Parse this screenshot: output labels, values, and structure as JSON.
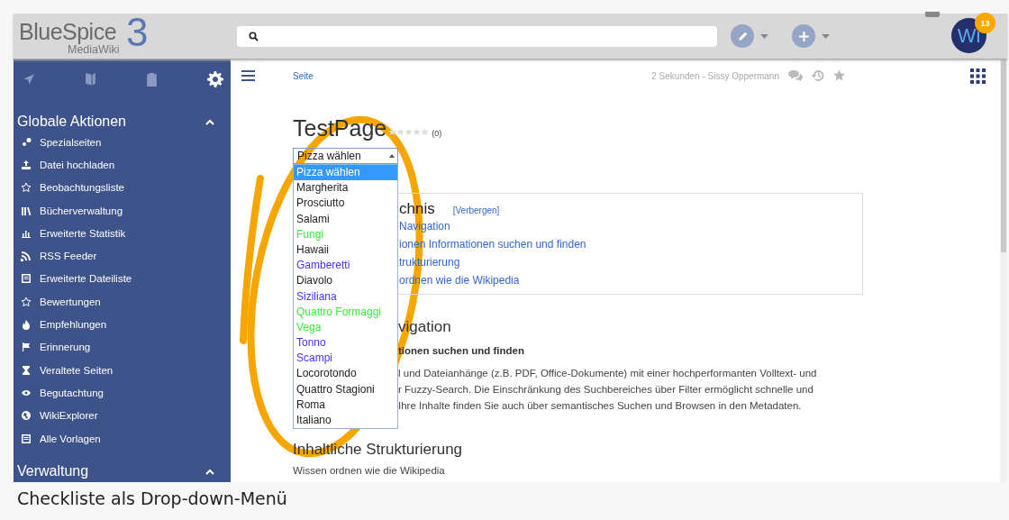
{
  "header": {
    "logo": {
      "name": "BlueSpice",
      "subtitle": "MediaWiki",
      "version": "3"
    },
    "avatar": {
      "initials": "Wi",
      "badge": "13"
    }
  },
  "sidebar": {
    "sections": [
      {
        "title": "Globale Aktionen",
        "expanded": true,
        "items": [
          "Spezialseiten",
          "Datei hochladen",
          "Beobachtungsliste",
          "Bücherverwaltung",
          "Erweiterte Statistik",
          "RSS Feeder",
          "Erweiterte Dateiliste",
          "Bewertungen",
          "Empfehlungen",
          "Erinnerung",
          "Veraltete Seiten",
          "Begutachtung",
          "WikiExplorer",
          "Alle Vorlagen"
        ]
      },
      {
        "title": "Verwaltung",
        "expanded": true
      }
    ]
  },
  "toolbar": {
    "breadcrumb": "Seite",
    "last_edit": "2 Sekunden - Sissy Oppermann"
  },
  "page": {
    "title": "TestPage",
    "rating": {
      "stars": 0,
      "count": "(0)"
    },
    "select": {
      "value": "Pizza wählen",
      "expanded": true,
      "options": [
        {
          "label": "Pizza wählen",
          "selected": true
        },
        {
          "label": "Margherita",
          "selected": false,
          "color": "#222222"
        },
        {
          "label": "Prosciutto",
          "selected": false,
          "color": "#222222"
        },
        {
          "label": "Salami",
          "selected": false,
          "color": "#222222"
        },
        {
          "label": "Fungi",
          "selected": false,
          "color": "#33ee33"
        },
        {
          "label": "Hawaii",
          "selected": false,
          "color": "#222222"
        },
        {
          "label": "Gamberetti",
          "selected": false,
          "color": "#4433ff"
        },
        {
          "label": "Diavolo",
          "selected": false,
          "color": "#222222"
        },
        {
          "label": "Siziliana",
          "selected": false,
          "color": "#4433ff"
        },
        {
          "label": "Quattro Formaggi",
          "selected": false,
          "color": "#33ee33"
        },
        {
          "label": "Vega",
          "selected": false,
          "color": "#33ee33"
        },
        {
          "label": "Tonno",
          "selected": false,
          "color": "#4433ff"
        },
        {
          "label": "Scampi",
          "selected": false,
          "color": "#4433ff"
        },
        {
          "label": "Locorotondo",
          "selected": false,
          "color": "#222222"
        },
        {
          "label": "Quattro Stagioni",
          "selected": false,
          "color": "#222222"
        },
        {
          "label": "Roma",
          "selected": false,
          "color": "#222222"
        },
        {
          "label": "Italiano",
          "selected": false,
          "color": "#222222"
        }
      ]
    },
    "toc": {
      "title": "chnis",
      "toggle": "[Verbergen]",
      "items": [
        "Navigation",
        "ionen Informationen suchen und finden",
        "trukturierung",
        "ordnen wie die Wikipedia"
      ]
    },
    "sections": [
      {
        "heading": "vigation",
        "subheading": "tionen suchen und finden",
        "lines": [
          "l und Dateianhänge (z.B. PDF, Office-Dokumente) mit einer hochperformanten Volltext- und",
          "r Fuzzy-Search. Die Einschränkung des Suchbereiches über Filter ermöglicht schnelle und",
          "Ihre Inhalte finden Sie auch über semantisches Suchen und Browsen in den Metadaten."
        ]
      },
      {
        "heading": "Inhaltliche Strukturierung",
        "lines": [
          "Wissen ordnen wie die Wikipedia"
        ]
      }
    ]
  },
  "caption": "Checkliste als Drop-down-Menü"
}
